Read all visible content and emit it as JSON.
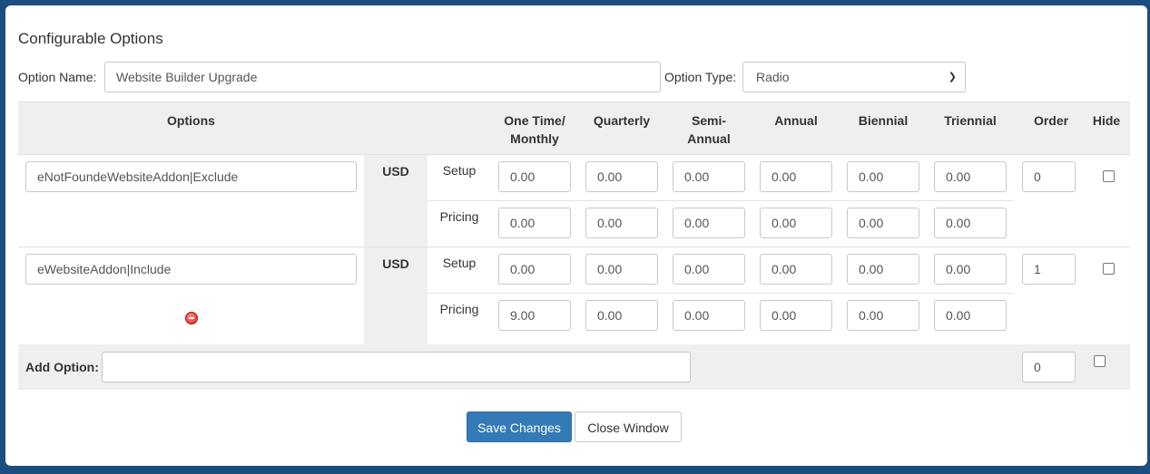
{
  "window": {
    "title": "Configurable Options",
    "option_name_label": "Option Name:",
    "option_name_value": "Website Builder Upgrade",
    "option_type_label": "Option Type:",
    "option_type_value": "Radio"
  },
  "table": {
    "headers": {
      "options": "Options",
      "one_time_a": "One Time/",
      "one_time_b": "Monthly",
      "quarterly": "Quarterly",
      "semi_a": "Semi-",
      "semi_b": "Annual",
      "annual": "Annual",
      "biennial": "Biennial",
      "triennial": "Triennial",
      "order": "Order",
      "hide": "Hide"
    },
    "rows": [
      {
        "name": "eNotFoundeWebsiteAddon|Exclude",
        "currency": "USD",
        "setup_label": "Setup",
        "pricing_label": "Pricing",
        "setup": [
          "0.00",
          "0.00",
          "0.00",
          "0.00",
          "0.00",
          "0.00"
        ],
        "pricing": [
          "0.00",
          "0.00",
          "0.00",
          "0.00",
          "0.00",
          "0.00"
        ],
        "order": "0",
        "hide": false
      },
      {
        "name": "eWebsiteAddon|Include",
        "currency": "USD",
        "setup_label": "Setup",
        "pricing_label": "Pricing",
        "setup": [
          "0.00",
          "0.00",
          "0.00",
          "0.00",
          "0.00",
          "0.00"
        ],
        "pricing": [
          "9.00",
          "0.00",
          "0.00",
          "0.00",
          "0.00",
          "0.00"
        ],
        "order": "1",
        "hide": false
      }
    ],
    "add_option_label": "Add Option:",
    "add_option_value": "",
    "add_option_order": "0"
  },
  "buttons": {
    "save": "Save Changes",
    "close": "Close Window"
  },
  "icons": {
    "remove": "remove-option-icon",
    "select_arrow": "chevron-down-icon"
  }
}
